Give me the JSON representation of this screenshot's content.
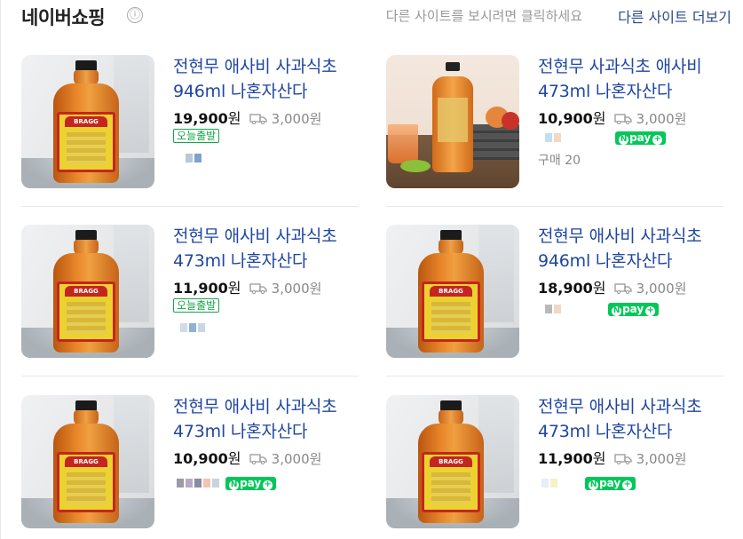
{
  "header": {
    "title": "네이버쇼핑",
    "info_icon": "ⓘ",
    "hint": "다른 사이트를 보시려면 클릭하세요",
    "more_link": "다른 사이트 더보기"
  },
  "products": [
    {
      "name": "전현무 애사비 사과식초 946ml 나혼자산다",
      "price": "19,900",
      "currency": "원",
      "shipping": "3,000원",
      "badge": "오늘출발",
      "npay": false,
      "buy_count": ""
    },
    {
      "name": "전현무 사과식초 애사비 473ml 나혼자산다",
      "price": "10,900",
      "currency": "원",
      "shipping": "3,000원",
      "badge": "",
      "npay": true,
      "npay_label": "pay",
      "buy_count": "구매 20"
    },
    {
      "name": "전현무 애사비 사과식초 473ml 나혼자산다",
      "price": "11,900",
      "currency": "원",
      "shipping": "3,000원",
      "badge": "오늘출발",
      "npay": false,
      "buy_count": ""
    },
    {
      "name": "전현무 애사비 사과식초 946ml 나혼자산다",
      "price": "18,900",
      "currency": "원",
      "shipping": "3,000원",
      "badge": "",
      "npay": true,
      "npay_label": "pay",
      "buy_count": ""
    },
    {
      "name": "전현무 애사비 사과식초 473ml 나혼자산다",
      "price": "10,900",
      "currency": "원",
      "shipping": "3,000원",
      "badge": "",
      "npay": true,
      "npay_label": "pay",
      "buy_count": ""
    },
    {
      "name": "전현무 애사비 사과식초 473ml 나혼자산다",
      "price": "11,900",
      "currency": "원",
      "shipping": "3,000원",
      "badge": "",
      "npay": true,
      "npay_label": "pay",
      "buy_count": ""
    }
  ],
  "bottle_brand": "BRAGG",
  "colors": {
    "link": "#1f46a0",
    "npay": "#03c75a",
    "today_badge": "#13a54a"
  }
}
